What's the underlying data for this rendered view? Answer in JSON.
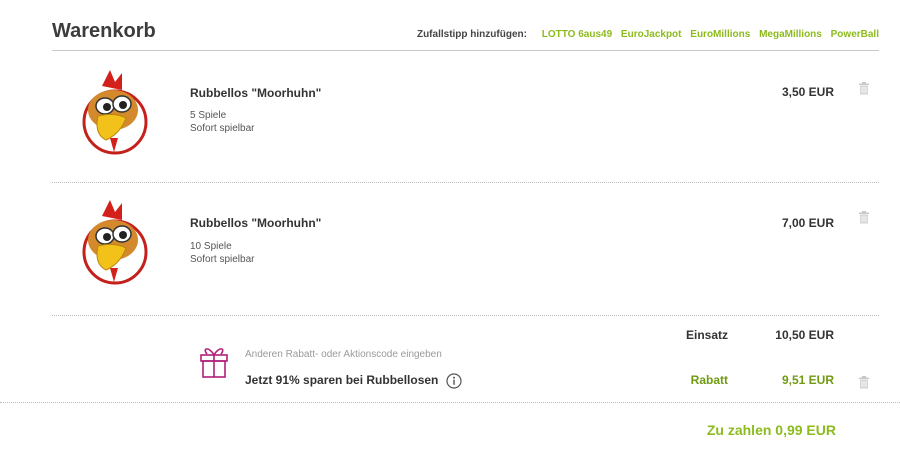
{
  "cart": {
    "title": "Warenkorb",
    "quicklinks_label": "Zufallstipp hinzufügen:",
    "quicklinks": [
      "LOTTO 6aus49",
      "EuroJackpot",
      "EuroMillions",
      "MegaMillions",
      "PowerBall"
    ]
  },
  "items": [
    {
      "title": "Rubbellos \"Moorhuhn\"",
      "games": "5 Spiele",
      "availability": "Sofort spielbar",
      "price": "3,50 EUR",
      "icon": "trash-icon"
    },
    {
      "title": "Rubbellos \"Moorhuhn\"",
      "games": "10 Spiele",
      "availability": "Sofort spielbar",
      "price": "7,00 EUR",
      "icon": "trash-icon"
    }
  ],
  "summary": {
    "stake_label": "Einsatz",
    "stake_value": "10,50 EUR",
    "discount_label": "Rabatt",
    "discount_value": "9,51 EUR",
    "promo_placeholder": "Anderen Rabatt- oder Aktionscode eingeben",
    "promo_text": "Jetzt 91% sparen bei Rubbellosen",
    "total": "Zu zahlen 0,99 EUR"
  },
  "colors": {
    "accent_green": "#8dbb1e",
    "discount_green": "#6f9a12",
    "gift_magenta": "#b0207a"
  }
}
